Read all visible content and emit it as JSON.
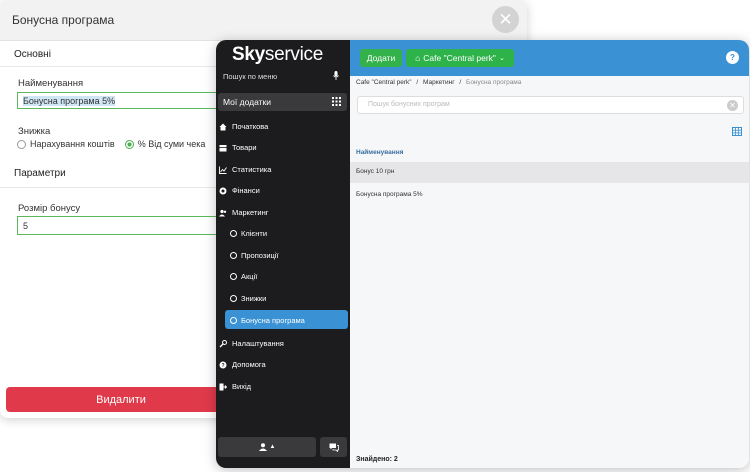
{
  "modal": {
    "title": "Бонусна програма",
    "section_main": "Основні",
    "name_label": "Найменування",
    "name_value": "Бонусна програма 5%",
    "discount_label": "Знижка",
    "radio_option_1": "Нарахування коштів",
    "radio_option_2": "% Від суми чека",
    "selected_option": "% Від суми чека",
    "section_params": "Параметри",
    "bonus_size_label": "Розмір бонусу",
    "bonus_size_value": "5",
    "delete_label": "Видалити"
  },
  "sidebar": {
    "logo_bold": "Sky",
    "logo_rest": "service",
    "search_placeholder": "Пошук по меню",
    "apps_label": "Мої додатки",
    "items": [
      {
        "label": "Початкова",
        "icon": "home-icon"
      },
      {
        "label": "Товари",
        "icon": "box-icon"
      },
      {
        "label": "Статистика",
        "icon": "chart-icon"
      },
      {
        "label": "Фінанси",
        "icon": "coin-icon"
      },
      {
        "label": "Маркетинг",
        "icon": "users-icon"
      }
    ],
    "sub_items": [
      "Клієнти",
      "Пропозиції",
      "Акції",
      "Знижки",
      "Бонусна програма"
    ],
    "active_sub": "Бонусна програма",
    "bottom_items": [
      {
        "label": "Налаштування",
        "icon": "wrench-icon"
      },
      {
        "label": "Допомога",
        "icon": "help-circle-icon"
      },
      {
        "label": "Вихід",
        "icon": "exit-icon"
      }
    ]
  },
  "topbar": {
    "add_label": "Додати",
    "store_label": "Cafe \"Central perk\"",
    "help_badge": "?"
  },
  "breadcrumb": {
    "part1": "Cafe \"Central perk\"",
    "part2": "Маркетинг",
    "current": "Бонусна програма",
    "separator": "/"
  },
  "search": {
    "placeholder": "Пошук бонусних програм"
  },
  "table": {
    "column": "Найменування",
    "rows": [
      "Бонус 10 грн",
      "Бонусна програма 5%"
    ]
  },
  "footer": {
    "found_text": "Знайдено: 2"
  },
  "colors": {
    "accent": "#3a92d5",
    "green": "#33b14b",
    "danger": "#e03a4a",
    "sidebar": "#1c1c1e"
  }
}
